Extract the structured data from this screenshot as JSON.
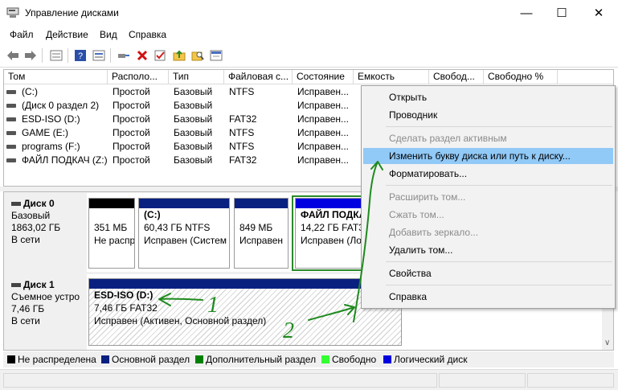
{
  "window": {
    "title": "Управление дисками",
    "minimize_glyph": "—",
    "maximize_glyph": "☐",
    "close_glyph": "✕"
  },
  "menu": [
    "Файл",
    "Действие",
    "Вид",
    "Справка"
  ],
  "toolbar": {
    "icons": [
      "back-icon",
      "forward-icon",
      "disk-list-icon",
      "help-icon",
      "properties-icon",
      "connect-icon",
      "delete-icon",
      "check-icon",
      "up-folder-icon",
      "search-icon",
      "console-icon"
    ]
  },
  "volumes": {
    "columns": [
      "Том",
      "Располо...",
      "Тип",
      "Файловая с...",
      "Состояние",
      "Емкость",
      "Свобод...",
      "Свободно %"
    ],
    "rows": [
      {
        "name": "(C:)",
        "layout": "Простой",
        "type": "Базовый",
        "fs": "NTFS",
        "status": "Исправен..."
      },
      {
        "name": "(Диск 0 раздел 2)",
        "layout": "Простой",
        "type": "Базовый",
        "fs": "",
        "status": "Исправен..."
      },
      {
        "name": "ESD-ISO (D:)",
        "layout": "Простой",
        "type": "Базовый",
        "fs": "FAT32",
        "status": "Исправен..."
      },
      {
        "name": "GAME (E:)",
        "layout": "Простой",
        "type": "Базовый",
        "fs": "NTFS",
        "status": "Исправен..."
      },
      {
        "name": "programs (F:)",
        "layout": "Простой",
        "type": "Базовый",
        "fs": "NTFS",
        "status": "Исправен..."
      },
      {
        "name": "ФАЙЛ ПОДКАЧ (Z:)",
        "layout": "Простой",
        "type": "Базовый",
        "fs": "FAT32",
        "status": "Исправен..."
      }
    ]
  },
  "disks": [
    {
      "name": "Диск 0",
      "type": "Базовый",
      "size": "1863,02 ГБ",
      "status": "В сети",
      "partitions": [
        {
          "title": "",
          "size": "351 МБ",
          "status": "Не распр",
          "bar": "#000000"
        },
        {
          "title": "(C:)",
          "size": "60,43 ГБ NTFS",
          "status": "Исправен (Систем",
          "bar": "#0a2080"
        },
        {
          "title": "",
          "size": "849 МБ",
          "status": "Исправен",
          "bar": "#0a2080"
        },
        {
          "title": "ФАЙЛ ПОДКА",
          "size": "14,22 ГБ FAT32",
          "status": "Исправен (Ло",
          "bar": "#0000e0"
        }
      ]
    },
    {
      "name": "Диск 1",
      "type": "Съемное устро",
      "size": "7,46 ГБ",
      "status": "В сети",
      "partitions": [
        {
          "title": "ESD-ISO  (D:)",
          "size": "7,46 ГБ FAT32",
          "status": "Исправен (Активен, Основной раздел)",
          "bar": "#0a2080"
        }
      ]
    }
  ],
  "legend": [
    {
      "label": "Не распределена",
      "color": "#000000"
    },
    {
      "label": "Основной раздел",
      "color": "#0a2080"
    },
    {
      "label": "Дополнительный раздел",
      "color": "#008000"
    },
    {
      "label": "Свободно",
      "color": "#33ff33"
    },
    {
      "label": "Логический диск",
      "color": "#0000e0"
    }
  ],
  "context_menu": [
    {
      "label": "Открыть",
      "disabled": false
    },
    {
      "label": "Проводник",
      "disabled": false
    },
    {
      "label": "Сделать раздел активным",
      "disabled": true
    },
    {
      "label": "Изменить букву диска или путь к диску...",
      "disabled": false,
      "highlighted": true
    },
    {
      "label": "Форматировать...",
      "disabled": false
    },
    {
      "label": "Расширить том...",
      "disabled": true
    },
    {
      "label": "Сжать том...",
      "disabled": true
    },
    {
      "label": "Добавить зеркало...",
      "disabled": true
    },
    {
      "label": "Удалить том...",
      "disabled": false
    },
    {
      "label": "Свойства",
      "disabled": false
    },
    {
      "label": "Справка",
      "disabled": false
    }
  ],
  "annotations": {
    "marker_1": "1",
    "marker_2": "2",
    "color": "#1e8a1e"
  },
  "colors": {
    "selection": "#91c9f7",
    "selected_partition_border": "#2a8a2a"
  }
}
